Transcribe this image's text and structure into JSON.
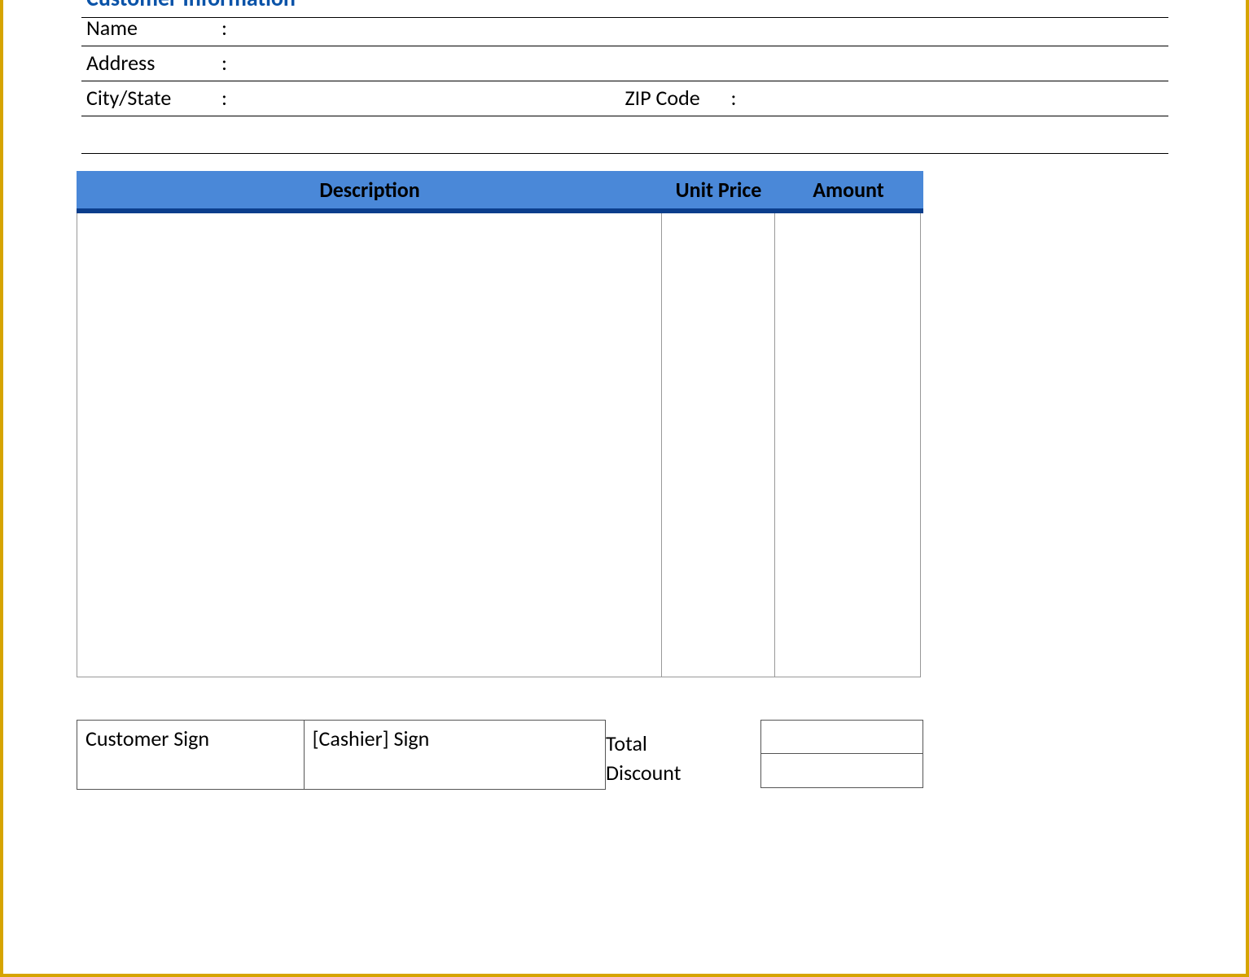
{
  "customer": {
    "section_title": "Customer Information",
    "name_label": "Name",
    "address_label": "Address",
    "citystate_label": "City/State",
    "zip_label": "ZIP Code",
    "colon": ":"
  },
  "columns": {
    "description": "Description",
    "unit_price": "Unit Price",
    "amount": "Amount"
  },
  "signatures": {
    "customer": "Customer Sign",
    "cashier": "[Cashier] Sign"
  },
  "totals": {
    "total": "Total",
    "discount": "Discount"
  }
}
